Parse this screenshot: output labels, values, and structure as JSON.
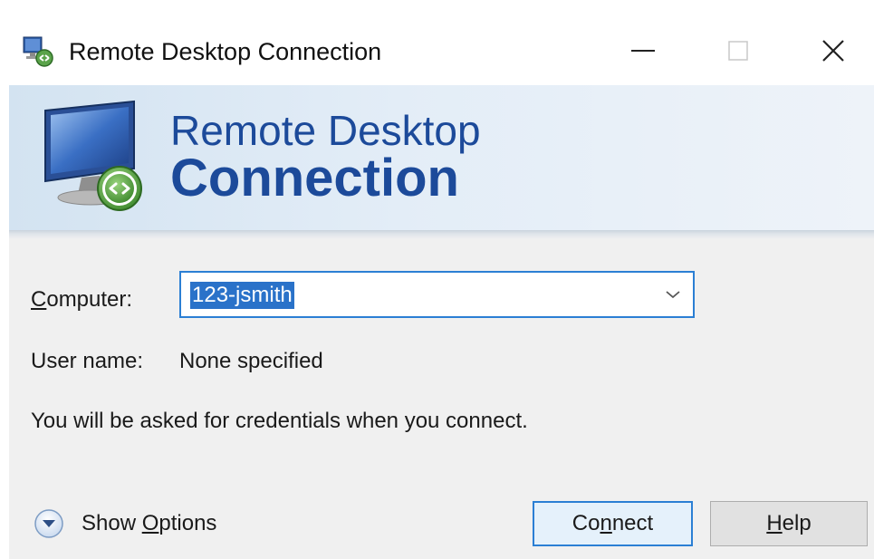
{
  "window": {
    "title": "Remote Desktop Connection",
    "icon": "remote-desktop-icon"
  },
  "title_buttons": {
    "minimize": "minimize-icon",
    "maximize": "maximize-icon",
    "close": "close-icon"
  },
  "banner": {
    "line1": "Remote Desktop",
    "line2": "Connection",
    "icon": "monitor-remote-icon"
  },
  "form": {
    "computer_label_first": "C",
    "computer_label_rest": "omputer:",
    "computer_value": "123-jsmith",
    "username_label": "User name:",
    "username_value": "None specified",
    "info": "You will be asked for credentials when you connect."
  },
  "footer": {
    "options_label_pre": "Show ",
    "options_label_ul": "O",
    "options_label_post": "ptions",
    "connect_pre": "Co",
    "connect_ul": "n",
    "connect_post": "nect",
    "help_ul": "H",
    "help_post": "elp"
  },
  "colors": {
    "accent": "#2b7fd4",
    "banner_text": "#1c4a9a",
    "selection": "#2a72c9"
  }
}
